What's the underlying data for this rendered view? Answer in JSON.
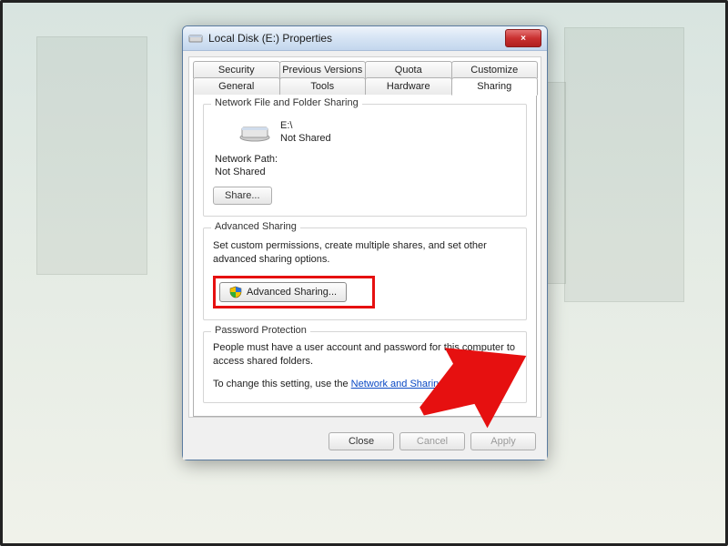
{
  "window": {
    "title": "Local Disk (E:) Properties",
    "close_icon": "×"
  },
  "tabs": {
    "row1": [
      "Security",
      "Previous Versions",
      "Quota",
      "Customize"
    ],
    "row2": [
      "General",
      "Tools",
      "Hardware",
      "Sharing"
    ],
    "active": "Sharing"
  },
  "sharing": {
    "group_title": "Network File and Folder Sharing",
    "drive_label": "E:\\",
    "drive_status": "Not Shared",
    "network_path_label": "Network Path:",
    "network_path_value": "Not Shared",
    "share_button": "Share..."
  },
  "advanced": {
    "group_title": "Advanced Sharing",
    "description": "Set custom permissions, create multiple shares, and set other advanced sharing options.",
    "button_label": "Advanced Sharing..."
  },
  "password": {
    "group_title": "Password Protection",
    "line1": "People must have a user account and password for this computer to access shared folders.",
    "line2_prefix": "To change this setting, use the ",
    "link_text": "Network and Sharing Center",
    "line2_suffix": "."
  },
  "footer": {
    "close": "Close",
    "cancel": "Cancel",
    "apply": "Apply"
  },
  "colors": {
    "highlight": "#e61010"
  }
}
